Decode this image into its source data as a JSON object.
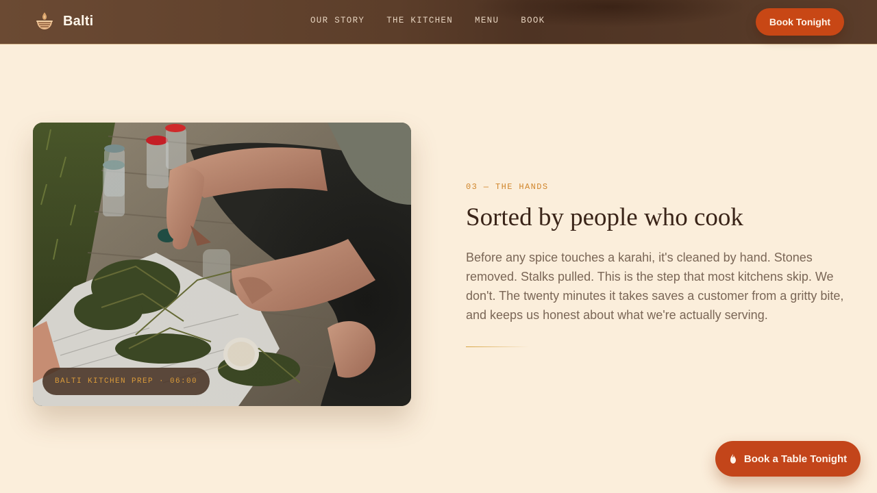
{
  "header": {
    "brand_name": "Balti",
    "logo_icon": "balti-bowl-icon",
    "nav": [
      {
        "label": "OUR STORY"
      },
      {
        "label": "THE KITCHEN"
      },
      {
        "label": "MENU"
      },
      {
        "label": "BOOK"
      }
    ],
    "cta_label": "Book Tonight"
  },
  "feature": {
    "photo_alt": "Hands sorting dried herbs on newspaper beside glass jars",
    "photo_tag": "BALTI KITCHEN PREP · 06:00",
    "eyebrow": "03 — THE HANDS",
    "title": "Sorted by people who cook",
    "body": "Before any spice touches a karahi, it's cleaned by hand. Stones removed. Stalks pulled. This is the step that most kitchens skip. We don't. The twenty minutes it takes saves a customer from a gritty bite, and keeps us honest about what we're actually serving."
  },
  "floating_cta": {
    "label": "Book a Table Tonight",
    "icon": "flame-icon"
  },
  "colors": {
    "background": "#fbeedb",
    "header": "#5c3e2a",
    "accent": "#c84715",
    "eyebrow": "#d0852b",
    "title": "#3a2418",
    "body": "#7a6656"
  }
}
